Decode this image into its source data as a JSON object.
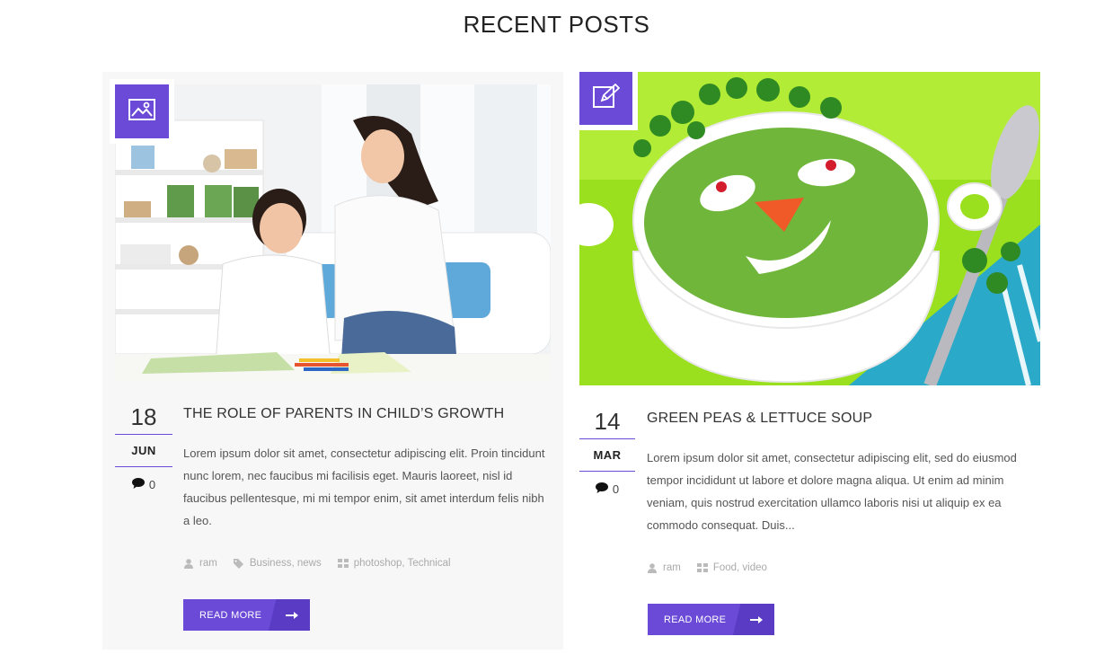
{
  "section": {
    "title": "RECENT POSTS"
  },
  "colors": {
    "accent": "#6a4ad6"
  },
  "posts": [
    {
      "format_icon": "image-icon",
      "image_alt": "Mother and son doing crafts at a table",
      "day": "18",
      "month": "JUN",
      "comments": "0",
      "title": "THE ROLE OF PARENTS IN CHILD’S GROWTH",
      "excerpt": "Lorem ipsum dolor sit amet, consectetur adipiscing elit. Proin tincidunt nunc lorem, nec faucibus mi facilisis eget. Mauris laoreet, nisl id faucibus pellentesque, mi mi tempor enim, sit amet interdum felis nibh a leo.",
      "author": "ram",
      "tags": "Business, news",
      "categories": "photoshop, Technical",
      "read_more": "READ MORE"
    },
    {
      "format_icon": "edit-icon",
      "image_alt": "Green pea soup with a smiley face",
      "day": "14",
      "month": "MAR",
      "comments": "0",
      "title": "GREEN PEAS & LETTUCE SOUP",
      "excerpt": "Lorem ipsum dolor sit amet, consectetur adipiscing elit, sed do eiusmod tempor incididunt ut labore et dolore magna aliqua. Ut enim ad minim veniam, quis nostrud exercitation ullamco laboris nisi ut aliquip ex ea commodo consequat. Duis...",
      "author": "ram",
      "categories": "Food, video",
      "read_more": "READ MORE"
    }
  ]
}
